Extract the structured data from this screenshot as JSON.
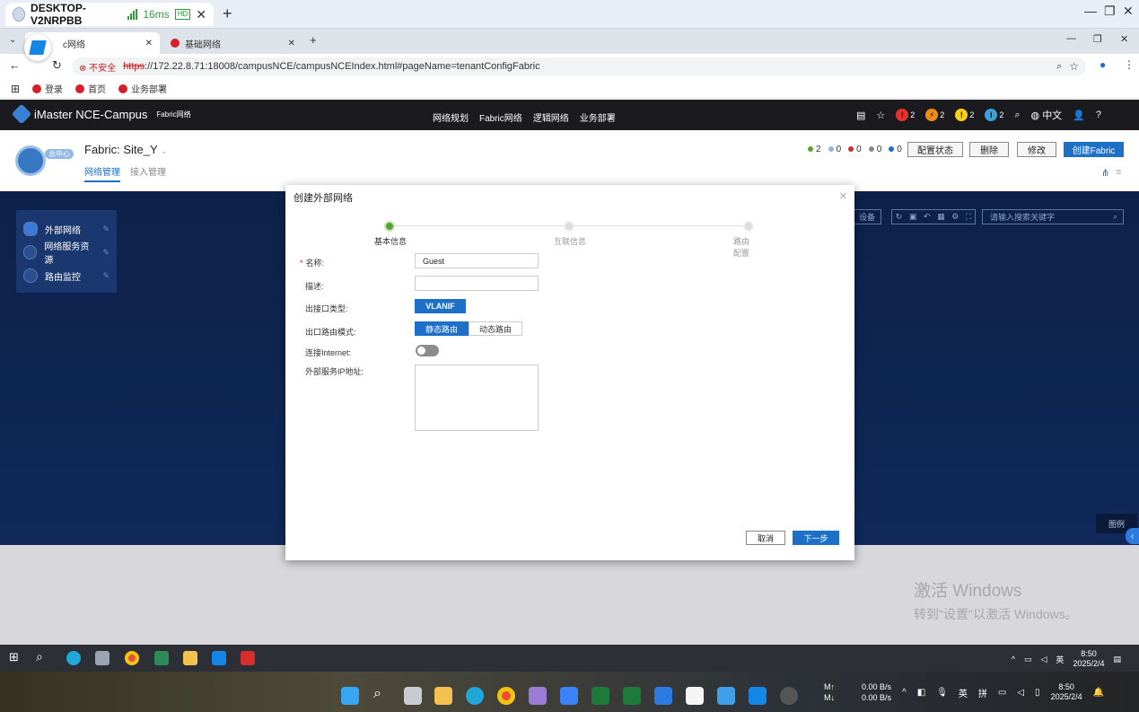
{
  "remote": {
    "title": "DESKTOP-V2NRPBB",
    "latency": "16ms",
    "hd": "HD"
  },
  "browser": {
    "tabs": [
      {
        "label": "c网络"
      },
      {
        "label": "基础网络"
      }
    ],
    "insecure": "不安全",
    "url_scheme": "https",
    "url_rest": "://172.22.8.71:18008/campusNCE/campusNCEIndex.html#pageName=tenantConfigFabric",
    "bookmarks": [
      "登录",
      "首页",
      "业务部署"
    ]
  },
  "app": {
    "brand": "iMaster NCE-Campus",
    "brand_sub": "Fabric网络",
    "menu": [
      "网络规划",
      "Fabric网络",
      "逻辑网络",
      "业务部署"
    ],
    "alarms": [
      {
        "count": "2",
        "color": "#e5322d",
        "glyph": "!"
      },
      {
        "count": "2",
        "color": "#f08c1a",
        "glyph": "⚡"
      },
      {
        "count": "2",
        "color": "#f5d018",
        "glyph": "!"
      },
      {
        "count": "2",
        "color": "#3aa0d8",
        "glyph": "i"
      }
    ],
    "lang": "中文"
  },
  "page": {
    "site_badge": "总中心",
    "fabric_title": "Fabric: Site_Y",
    "subtabs": [
      "网络管理",
      "接入管理"
    ],
    "stats": [
      {
        "color": "#55a532",
        "value": "2"
      },
      {
        "color": "#8fb8e6",
        "value": "0"
      },
      {
        "color": "#d12d2d",
        "value": "0"
      },
      {
        "color": "#888888",
        "value": "0"
      },
      {
        "color": "#1e6fc8",
        "value": "0"
      }
    ],
    "buttons": {
      "config_status": "配置状态",
      "delete": "删除",
      "modify": "修改",
      "create_fabric": "创建Fabric"
    }
  },
  "sidebar": {
    "items": [
      {
        "label": "外部网络"
      },
      {
        "label": "网络服务资源"
      },
      {
        "label": "路由监控"
      }
    ]
  },
  "toolbar": {
    "device_btn": "设备",
    "search_placeholder": "请输入搜索关键字",
    "legend": "图例"
  },
  "modal": {
    "title": "创建外部网络",
    "steps": [
      "基本信息",
      "互联信息",
      "路由配置"
    ],
    "fields": {
      "name_label": "名称:",
      "name_value": "Guest",
      "desc_label": "描述:",
      "desc_value": "",
      "egress_type_label": "出接口类型:",
      "egress_type_value": "VLANIF",
      "route_mode_label": "出口路由模式:",
      "route_static": "静态路由",
      "route_dynamic": "动态路由",
      "internet_label": "连接Internet:",
      "ext_ip_label": "外部服务IP地址:"
    },
    "cancel": "取消",
    "next": "下一步"
  },
  "watermark": {
    "line1": "激活 Windows",
    "line2": "转到\"设置\"以激活 Windows。"
  },
  "inner_taskbar": {
    "ime": "英",
    "time": "8:50",
    "date": "2025/2/4"
  },
  "host_taskbar": {
    "net_up_label": "M↑",
    "net_up": "0.00 B/s",
    "net_down_label": "M↓",
    "net_down": "0.00 B/s",
    "ime1": "英",
    "ime2": "拼",
    "time": "8:50",
    "date": "2025/2/4"
  }
}
